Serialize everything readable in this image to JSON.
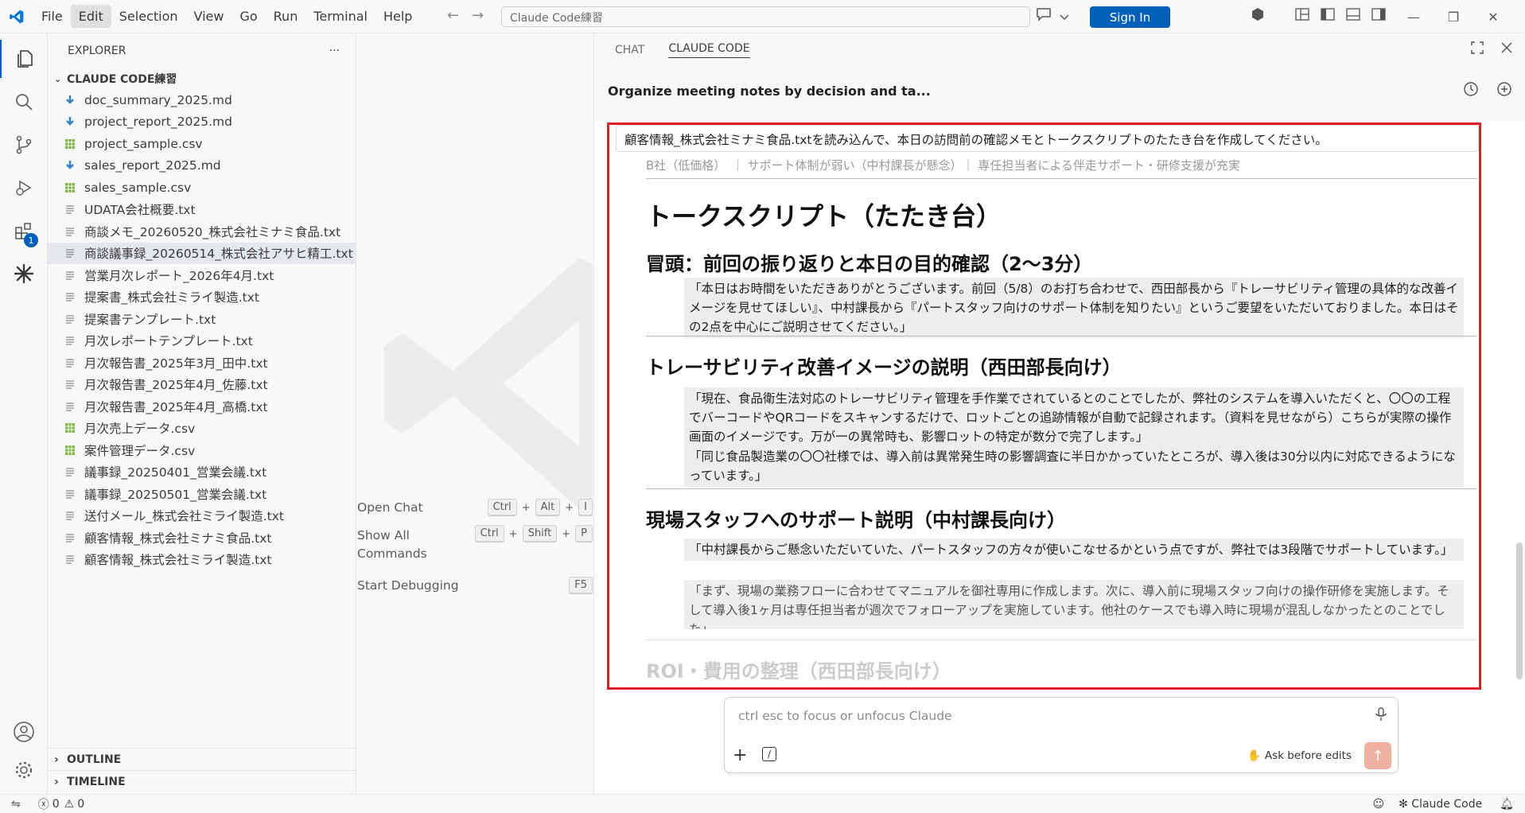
{
  "titlebar": {
    "menu": [
      "File",
      "Edit",
      "Selection",
      "View",
      "Go",
      "Run",
      "Terminal",
      "Help"
    ],
    "search_placeholder": "Claude Code練習",
    "sign_in": "Sign In"
  },
  "activity_badge": "1",
  "explorer": {
    "title": "EXPLORER",
    "more": "···",
    "folder": "CLAUDE CODE練習",
    "files": [
      {
        "name": "doc_summary_2025.md",
        "type": "md"
      },
      {
        "name": "project_report_2025.md",
        "type": "md"
      },
      {
        "name": "project_sample.csv",
        "type": "csv"
      },
      {
        "name": "sales_report_2025.md",
        "type": "md"
      },
      {
        "name": "sales_sample.csv",
        "type": "csv"
      },
      {
        "name": "UDATA会社概要.txt",
        "type": "txt"
      },
      {
        "name": "商談メモ_20260520_株式会社ミナミ食品.txt",
        "type": "txt"
      },
      {
        "name": "商談議事録_20260514_株式会社アサヒ精工.txt",
        "type": "txt"
      },
      {
        "name": "営業月次レポート_2026年4月.txt",
        "type": "txt"
      },
      {
        "name": "提案書_株式会社ミライ製造.txt",
        "type": "txt"
      },
      {
        "name": "提案書テンプレート.txt",
        "type": "txt"
      },
      {
        "name": "月次レポートテンプレート.txt",
        "type": "txt"
      },
      {
        "name": "月次報告書_2025年3月_田中.txt",
        "type": "txt"
      },
      {
        "name": "月次報告書_2025年4月_佐藤.txt",
        "type": "txt"
      },
      {
        "name": "月次報告書_2025年4月_高橋.txt",
        "type": "txt"
      },
      {
        "name": "月次売上データ.csv",
        "type": "csv"
      },
      {
        "name": "案件管理データ.csv",
        "type": "csv"
      },
      {
        "name": "議事録_20250401_営業会議.txt",
        "type": "txt"
      },
      {
        "name": "議事録_20250501_営業会議.txt",
        "type": "txt"
      },
      {
        "name": "送付メール_株式会社ミライ製造.txt",
        "type": "txt"
      },
      {
        "name": "顧客情報_株式会社ミナミ食品.txt",
        "type": "txt"
      },
      {
        "name": "顧客情報_株式会社ミライ製造.txt",
        "type": "txt"
      }
    ],
    "outline": "OUTLINE",
    "timeline": "TIMELINE"
  },
  "editor": {
    "shortcuts": [
      {
        "label": "Open Chat",
        "keys": [
          "Ctrl",
          "Alt",
          "I"
        ]
      },
      {
        "label": "Show All\nCommands",
        "keys": [
          "Ctrl",
          "Shift",
          "P"
        ]
      },
      {
        "label": "Start Debugging",
        "keys": [
          "F5"
        ]
      }
    ]
  },
  "panel": {
    "tabs": [
      "CHAT",
      "CLAUDE CODE"
    ],
    "conversation_title": "Organize meeting notes by decision and ta...",
    "user_message": "顧客情報_株式会社ミナミ食品.txtを読み込んで、本日の訪問前の確認メモとトークスクリプトのたたき台を作成してください。",
    "ghost_table_row": "B社（低価格）　｜ サポート体制が弱い（中村課長が懸念）｜ 専任担当者による伴走サポート・研修支援が充実",
    "h1": "トークスクリプト（たたき台）",
    "sections": [
      {
        "heading": "冒頭：前回の振り返りと本日の目的確認（2〜3分）",
        "quotes": [
          "「本日はお時間をいただきありがとうございます。前回（5/8）のお打ち合わせで、西田部長から『トレーサビリティ管理の具体的な改善イメージを見せてほしい』、中村課長から『パートスタッフ向けのサポート体制を知りたい』というご要望をいただいておりました。本日はその2点を中心にご説明させてください。」"
        ]
      },
      {
        "heading": "トレーサビリティ改善イメージの説明（西田部長向け）",
        "quotes": [
          "「現在、食品衛生法対応のトレーサビリティ管理を手作業でされているとのことでしたが、弊社のシステムを導入いただくと、〇〇の工程でバーコードやQRコードをスキャンするだけで、ロットごとの追跡情報が自動で記録されます。（資料を見せながら）こちらが実際の操作画面のイメージです。万が一の異常時も、影響ロットの特定が数分で完了します。」",
          "「同じ食品製造業の〇〇社様では、導入前は異常発生時の影響調査に半日かかっていたところが、導入後は30分以内に対応できるようになっています。」"
        ]
      },
      {
        "heading": "現場スタッフへのサポート説明（中村課長向け）",
        "quotes": [
          "「中村課長からご懸念いただいていた、パートスタッフの方々が使いこなせるかという点ですが、弊社では3段階でサポートしています。」",
          "「まず、現場の業務フローに合わせてマニュアルを御社専用に作成します。次に、導入前に現場スタッフ向けの操作研修を実施します。そして導入後1ヶ月は専任担当者が週次でフォローアップを実施しています。他社のケースでも導入時に現場が混乱しなかったとのことでした」"
        ]
      }
    ],
    "faded_heading": "ROI・費用の整理（西田部長向け）",
    "input_placeholder": "ctrl esc to focus or unfocus Claude",
    "ask_mode": "Ask before edits"
  },
  "status": {
    "errors": "0",
    "warnings": "0",
    "claude": "✻ Claude Code"
  }
}
